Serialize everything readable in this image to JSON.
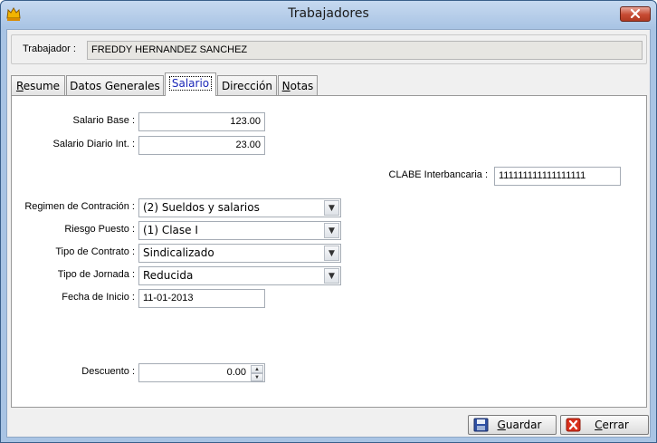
{
  "window": {
    "title": "Trabajadores",
    "icon": "app-logo-icon",
    "close_icon": "close-icon"
  },
  "header": {
    "worker_label": "Trabajador :",
    "worker_value": "FREDDY HERNANDEZ SANCHEZ"
  },
  "tabs": [
    {
      "label": "Resume",
      "access_key": "R",
      "rest": "esume",
      "active": false
    },
    {
      "label": "Datos Generales",
      "access_key": "",
      "rest": "Datos Generales",
      "active": false
    },
    {
      "label": "Salario",
      "access_key": "",
      "rest": "Salario",
      "active": true
    },
    {
      "label": "Dirección",
      "access_key": "",
      "rest": "Dirección",
      "active": false
    },
    {
      "label": "Notas",
      "access_key": "N",
      "rest": "otas",
      "active": false
    }
  ],
  "salario": {
    "base_label": "Salario Base :",
    "base_value": "123.00",
    "diario_label": "Salario Diario Int. :",
    "diario_value": "23.00",
    "clabe_label": "CLABE Interbancaria :",
    "clabe_value": "111111111111111111",
    "regimen_label": "Regimen de Contración :",
    "regimen_value": "(2) Sueldos y salarios",
    "riesgo_label": "Riesgo Puesto :",
    "riesgo_value": "(1) Clase I",
    "contrato_label": "Tipo de Contrato :",
    "contrato_value": "Sindicalizado",
    "jornada_label": "Tipo de Jornada :",
    "jornada_value": "Reducida",
    "fecha_label": "Fecha de Inicio :",
    "fecha_value": "11-01-2013",
    "descuento_label": "Descuento :",
    "descuento_value": "0.00"
  },
  "buttons": {
    "guardar": {
      "key": "G",
      "rest": "uardar",
      "icon": "floppy-disk-icon"
    },
    "cerrar": {
      "key": "C",
      "rest": "errar",
      "icon": "red-x-icon"
    }
  },
  "colors": {
    "active_tab_text": "#1b28b8",
    "close_button": "#c74a32",
    "titlebar": "#a9c4e4"
  }
}
